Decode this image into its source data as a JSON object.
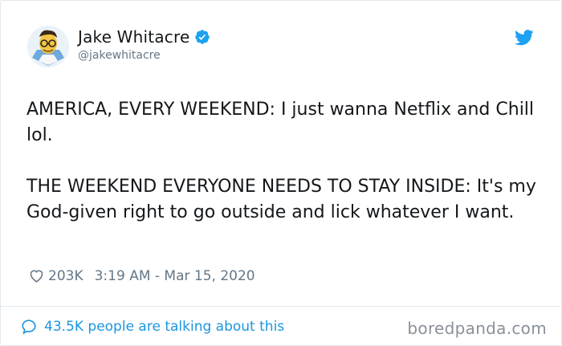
{
  "user": {
    "display_name": "Jake Whitacre",
    "handle": "@jakewhitacre",
    "verified": true,
    "avatar_icon": "cartoon-avatar-icon"
  },
  "tweet": {
    "text": "AMERICA, EVERY WEEKEND: I just wanna Netflix and Chill lol.\n\nTHE WEEKEND EVERYONE NEEDS TO STAY INSIDE: It's my God-given right to go outside and lick whatever I want.",
    "likes": "203K",
    "timestamp": "3:19 AM - Mar 15, 2020"
  },
  "footer": {
    "talking_label": "43.5K people are talking about this"
  },
  "watermark": "boredpanda.com",
  "colors": {
    "accent": "#1da1f2",
    "link": "#1b95e0",
    "muted": "#657786",
    "text": "#14171a",
    "border": "#e1e8ed"
  }
}
